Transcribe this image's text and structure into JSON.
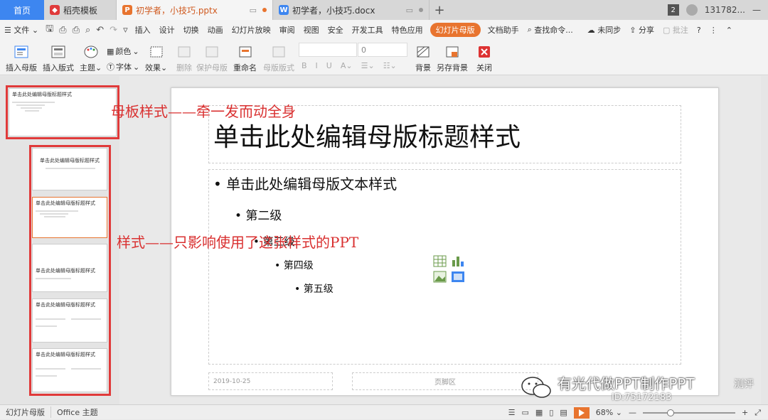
{
  "tabs": {
    "home": "首页",
    "template": "稻壳模板",
    "pptx": "初学者，小技巧.pptx",
    "docx": "初学者，小技巧.docx",
    "count": "2",
    "user": "131782..."
  },
  "menu": {
    "file": "文件",
    "items": [
      "插入",
      "设计",
      "切换",
      "动画",
      "幻灯片放映",
      "审阅",
      "视图",
      "安全",
      "开发工具",
      "特色应用"
    ],
    "active": "幻灯片母版",
    "assistant": "文档助手",
    "search": "查找命令...",
    "sync": "未同步",
    "share": "分享",
    "comment": "批注"
  },
  "ribbon": {
    "insert_master": "插入母版",
    "insert_layout": "插入版式",
    "theme": "主题",
    "color": "颜色",
    "font": "字体",
    "effect": "效果",
    "delete": "删除",
    "preserve_master": "保护母版",
    "rename": "重命名",
    "master_layout": "母版版式",
    "font_size": "0",
    "background": "背景",
    "save_background": "另存背景",
    "close": "关闭"
  },
  "thumbnails": {
    "master_title": "单击此处编辑母版标题样式",
    "layout_title": "单击此处编辑母版标题样式",
    "layout_body": "单击此处编辑母版文本样式"
  },
  "slide": {
    "title": "单击此处编辑母版标题样式",
    "level1": "• 单击此处编辑母版文本样式",
    "level2": "• 第二级",
    "level3": "• 第三级",
    "level4": "• 第四级",
    "level5": "• 第五级",
    "date": "2019-10-25",
    "footer": "页脚区"
  },
  "annotations": {
    "master": "母板样式——牵一发而动全身",
    "layout": "样式——只影响使用了这张样式的PPT"
  },
  "watermark": {
    "line1": "有光代做PPT制作PPT",
    "line2": "ID:75172183",
    "suffix": "测评"
  },
  "status": {
    "view": "幻灯片母版",
    "theme": "Office 主题",
    "zoom": "68%"
  },
  "colors": {
    "accent": "#e8742f",
    "annotation": "#d93030",
    "home_tab": "#3d86f0"
  }
}
